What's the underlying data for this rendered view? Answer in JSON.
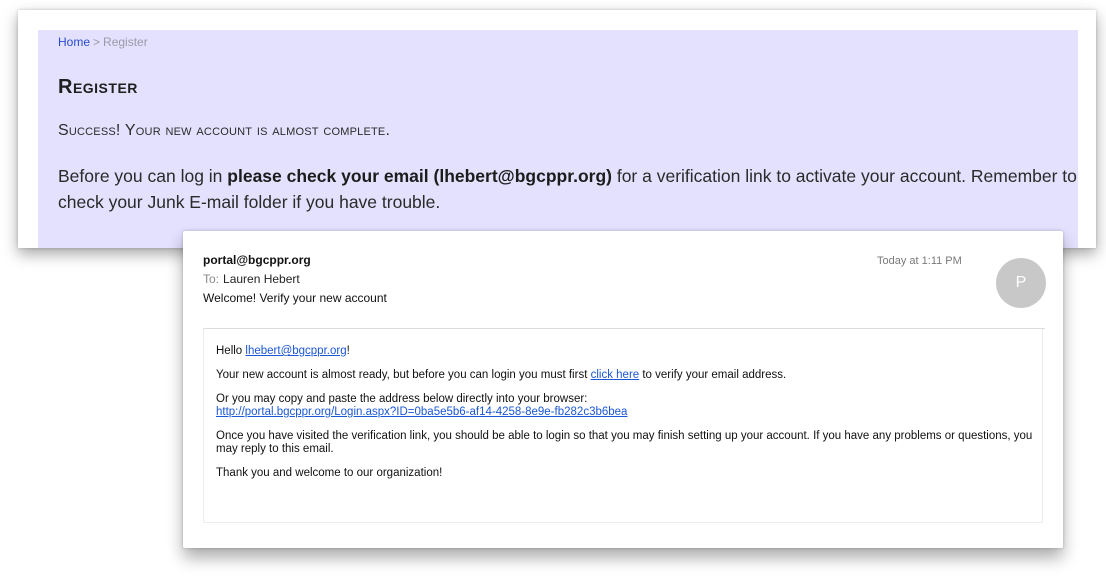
{
  "registration": {
    "breadcrumb": {
      "home": "Home",
      "separator": ">",
      "current": "Register"
    },
    "title": "Register",
    "success_text": "Success! Your new account is almost complete.",
    "instruction": {
      "prefix": "Before you can log in ",
      "bold": "please check your email (lhebert@bgcppr.org)",
      "suffix": " for a verification link to activate your account. Remember to check your Junk E-mail folder if you have trouble."
    }
  },
  "email": {
    "from": "portal@bgcppr.org",
    "to_label": "To:",
    "to_name": "Lauren Hebert",
    "subject": "Welcome! Verify your new account",
    "timestamp": "Today at 1:11 PM",
    "avatar_initial": "P",
    "body": {
      "greeting_prefix": "Hello ",
      "greeting_email": "lhebert@bgcppr.org",
      "greeting_suffix": "!",
      "line1_prefix": "Your new account is almost ready, but before you can login you must first ",
      "line1_link": "click here",
      "line1_suffix": " to verify your email address.",
      "line2": "Or you may copy and paste the address below directly into your browser:",
      "verify_url": "http://portal.bgcppr.org/Login.aspx?ID=0ba5e5b6-af14-4258-8e9e-fb282c3b6bea",
      "line3": "Once you have visited the verification link, you should be able to login so that you may finish setting up your account. If you have any problems or questions, you may reply to this email.",
      "closing": "Thank you and welcome to our organization!"
    }
  },
  "colors": {
    "panel_background": "#e3e1fd",
    "link": "#1b57d4",
    "breadcrumb_home": "#2a4ccf",
    "avatar_background": "#c8c8c8"
  }
}
